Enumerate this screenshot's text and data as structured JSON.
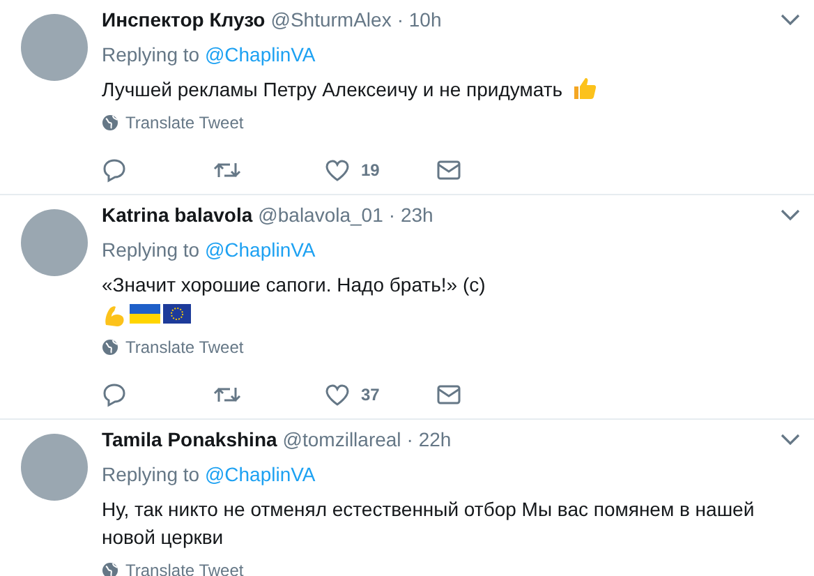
{
  "tweets": [
    {
      "name": "Инспектор Клузо",
      "handle": "@ShturmAlex",
      "time": "· 10h",
      "replying_label": "Replying to",
      "replying_to": "@ChaplinVA",
      "lines": [
        "Лучшей рекламы Петру Алексеичу и не придумать"
      ],
      "emoji_inline": [
        {
          "kind": "thumbs_up"
        }
      ],
      "translate": "Translate Tweet",
      "likes": "19"
    },
    {
      "name": "Katrina balavola",
      "handle": "@balavola_01",
      "time": "· 23h",
      "replying_label": "Replying to",
      "replying_to": "@ChaplinVA",
      "lines": [
        "«Значит хорошие сапоги.  Надо брать!» (с)"
      ],
      "emoji_line": [
        {
          "kind": "flexed_arm"
        },
        {
          "kind": "flag_ukraine"
        },
        {
          "kind": "flag_eu"
        }
      ],
      "translate": "Translate Tweet",
      "likes": "37"
    },
    {
      "name": "Tamila Ponakshina",
      "handle": "@tomzillareal",
      "time": "· 22h",
      "replying_label": "Replying to",
      "replying_to": "@ChaplinVA",
      "lines": [
        "Ну, так никто не отменял естественный отбор Мы вас помянем  в нашей новой церкви"
      ],
      "translate": "Translate Tweet"
    }
  ]
}
